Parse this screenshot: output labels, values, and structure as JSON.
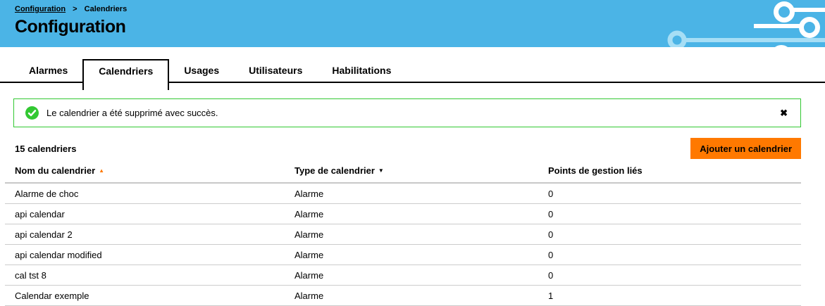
{
  "colors": {
    "header_blue": "#4bb4e6",
    "accent_orange": "#ff7900",
    "success_green": "#32c832"
  },
  "breadcrumb": {
    "items": [
      "Configuration",
      "Calendriers"
    ],
    "separator": ">"
  },
  "header": {
    "title": "Configuration"
  },
  "tabs": [
    {
      "label": "Alarmes",
      "active": false
    },
    {
      "label": "Calendriers",
      "active": true
    },
    {
      "label": "Usages",
      "active": false
    },
    {
      "label": "Utilisateurs",
      "active": false
    },
    {
      "label": "Habilitations",
      "active": false
    }
  ],
  "alert": {
    "message": "Le calendrier a été supprimé avec succès."
  },
  "icons": {
    "close": "✖",
    "sort_asc": "▲",
    "sort_desc": "▼",
    "success": "check-circle"
  },
  "toolbar": {
    "count_label": "15 calendriers",
    "add_button_label": "Ajouter un calendrier"
  },
  "table": {
    "columns": [
      {
        "label": "Nom du calendrier",
        "sorted": "asc"
      },
      {
        "label": "Type de calendrier",
        "sortable": true
      },
      {
        "label": "Points de gestion liés"
      }
    ],
    "rows": [
      [
        "Alarme de choc",
        "Alarme",
        "0"
      ],
      [
        "api calendar",
        "Alarme",
        "0"
      ],
      [
        "api calendar 2",
        "Alarme",
        "0"
      ],
      [
        "api calendar modified",
        "Alarme",
        "0"
      ],
      [
        "cal tst 8",
        "Alarme",
        "0"
      ],
      [
        "Calendar exemple",
        "Alarme",
        "1"
      ]
    ]
  }
}
